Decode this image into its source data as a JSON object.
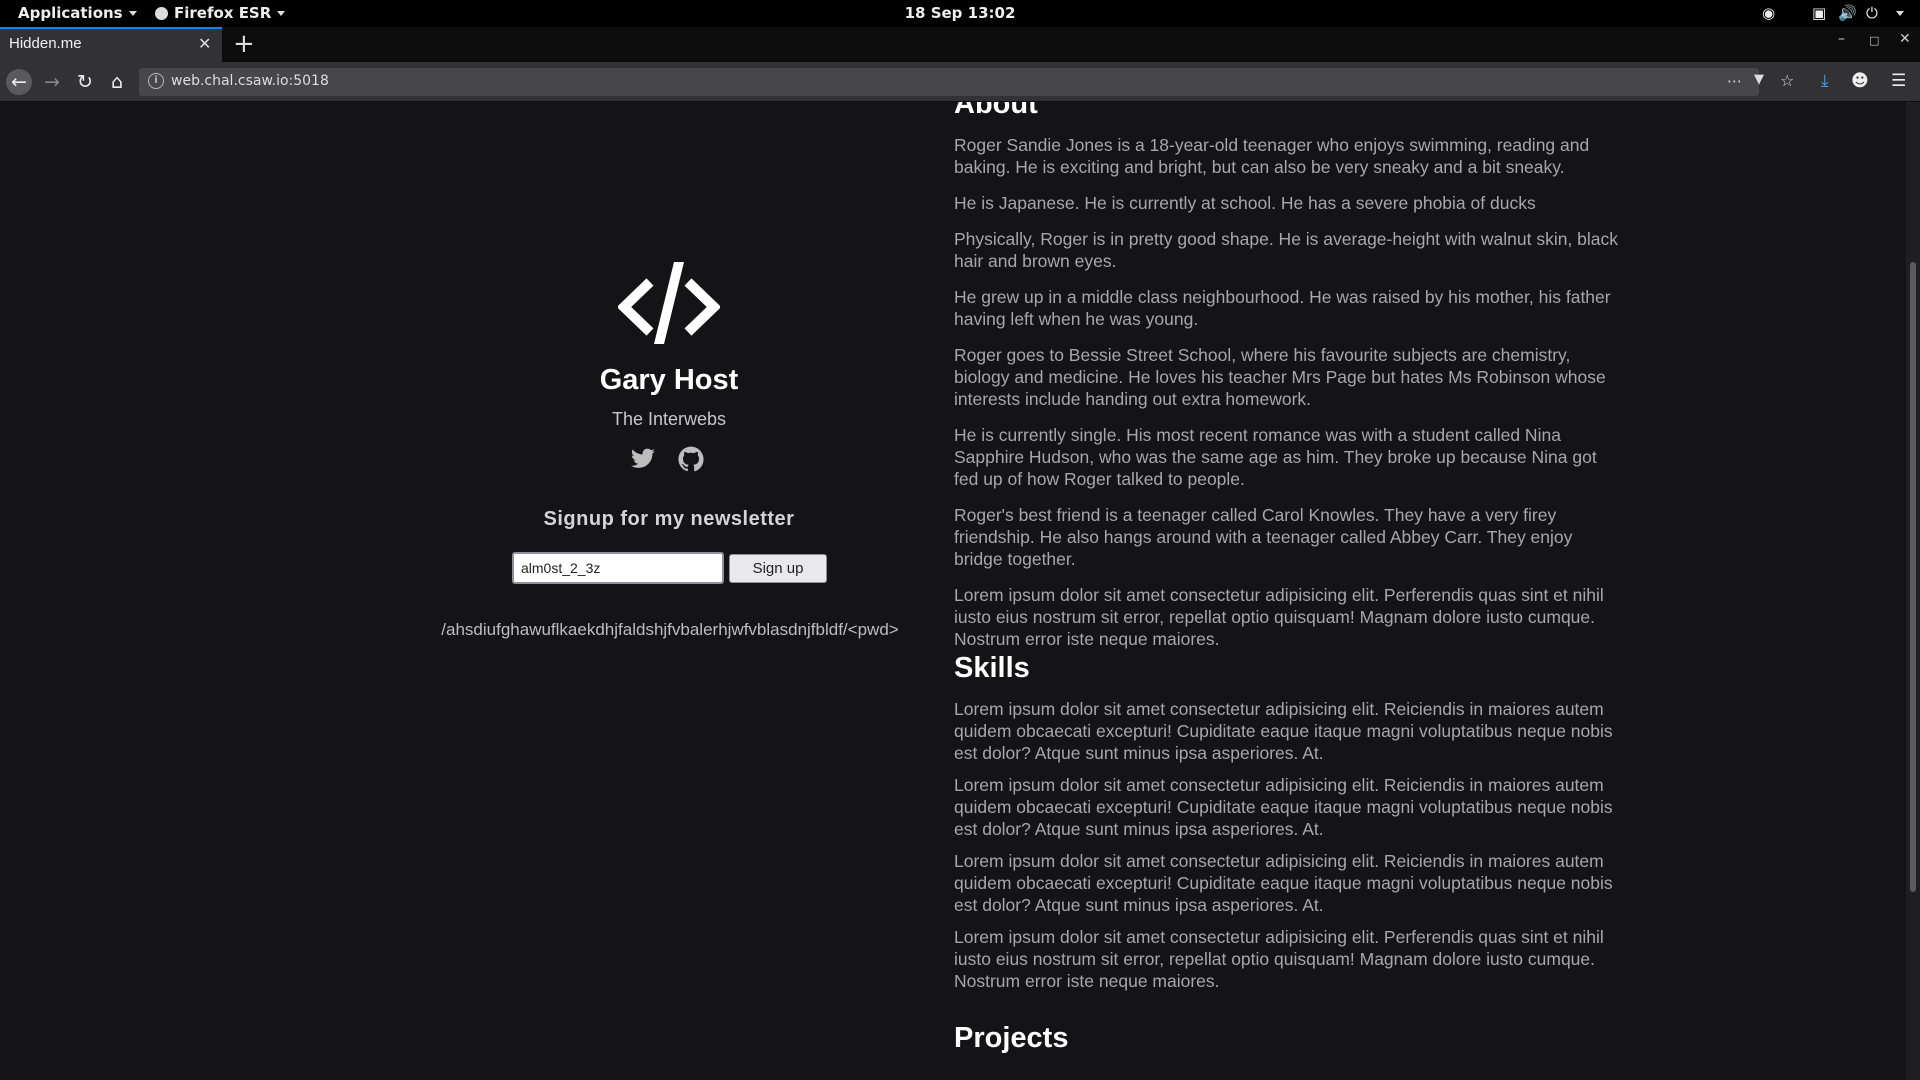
{
  "system_bar": {
    "applications_label": "Applications",
    "firefox_label": "Firefox ESR",
    "clock": "18 Sep  13:02"
  },
  "browser": {
    "tab_title": "Hidden.me",
    "url": "web.chal.csaw.io:5018"
  },
  "profile": {
    "name": "Gary Host",
    "location": "The Interwebs",
    "newsletter_heading": "Signup for my newsletter",
    "email_value": "alm0st_2_3z",
    "signup_label": "Sign up",
    "hidden_path": "/ahsdiufghawuflkaekdhjfaldshjfvbalerhjwfvblasdnjfbldf/<pwd>"
  },
  "about": {
    "heading": "About",
    "paragraphs": [
      "Roger Sandie Jones is a 18-year-old teenager who enjoys swimming, reading and baking. He is exciting and bright, but can also be very sneaky and a bit sneaky.",
      "He is Japanese. He is currently at school. He has a severe phobia of ducks",
      "Physically, Roger is in pretty good shape. He is average-height with walnut skin, black hair and brown eyes.",
      "He grew up in a middle class neighbourhood. He was raised by his mother, his father having left when he was young.",
      "Roger goes to Bessie Street School, where his favourite subjects are chemistry, biology and medicine. He loves his teacher Mrs Page but hates Ms Robinson whose interests include handing out extra homework.",
      "He is currently single. His most recent romance was with a student called Nina Sapphire Hudson, who was the same age as him. They broke up because Nina got fed up of how Roger talked to people.",
      "Roger's best friend is a teenager called Carol Knowles. They have a very firey friendship. He also hangs around with a teenager called Abbey Carr. They enjoy bridge together.",
      "Lorem ipsum dolor sit amet consectetur adipisicing elit. Perferendis quas sint et nihil iusto eius nostrum sit error, repellat optio quisquam! Magnam dolore iusto cumque. Nostrum error iste neque maiores."
    ]
  },
  "skills": {
    "heading": "Skills",
    "paragraphs": [
      "Lorem ipsum dolor sit amet consectetur adipisicing elit. Reiciendis in maiores autem quidem obcaecati excepturi! Cupiditate eaque itaque magni voluptatibus neque nobis est dolor? Atque sunt minus ipsa asperiores. At.",
      "Lorem ipsum dolor sit amet consectetur adipisicing elit. Reiciendis in maiores autem quidem obcaecati excepturi! Cupiditate eaque itaque magni voluptatibus neque nobis est dolor? Atque sunt minus ipsa asperiores. At.",
      "Lorem ipsum dolor sit amet consectetur adipisicing elit. Reiciendis in maiores autem quidem obcaecati excepturi! Cupiditate eaque itaque magni voluptatibus neque nobis est dolor? Atque sunt minus ipsa asperiores. At.",
      "Lorem ipsum dolor sit amet consectetur adipisicing elit. Perferendis quas sint et nihil iusto eius nostrum sit error, repellat optio quisquam! Magnam dolore iusto cumque. Nostrum error iste neque maiores."
    ]
  },
  "projects": {
    "heading": "Projects"
  }
}
